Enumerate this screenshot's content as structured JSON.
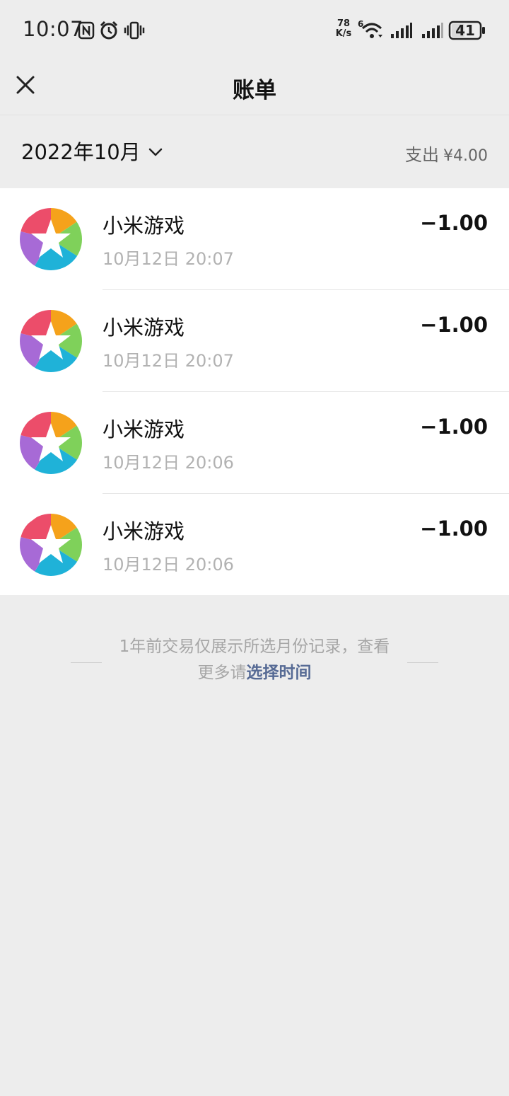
{
  "status_bar": {
    "time": "10:07",
    "net_speed_value": "78",
    "net_speed_unit": "K/s",
    "wifi_badge": "6",
    "battery": "41",
    "icons": [
      "nfc-icon",
      "alarm-icon",
      "vibrate-icon",
      "wifi-icon",
      "signal-icon",
      "signal-icon",
      "battery-icon"
    ]
  },
  "header": {
    "title": "账单",
    "close_icon": "close-icon"
  },
  "summary": {
    "month": "2022年10月",
    "expense_label": "支出",
    "expense_amount": "¥4.00"
  },
  "transactions": [
    {
      "merchant": "小米游戏",
      "time": "10月12日 20:07",
      "amount": "−1.00"
    },
    {
      "merchant": "小米游戏",
      "time": "10月12日 20:07",
      "amount": "−1.00"
    },
    {
      "merchant": "小米游戏",
      "time": "10月12日 20:06",
      "amount": "−1.00"
    },
    {
      "merchant": "小米游戏",
      "time": "10月12日 20:06",
      "amount": "−1.00"
    }
  ],
  "footer_note": {
    "text": "1年前交易仅展示所选月份记录，查看更多请",
    "link": "选择时间"
  },
  "colors": {
    "background": "#ededed",
    "card": "#ffffff",
    "link": "#576b95",
    "muted": "#b2b2b2"
  }
}
